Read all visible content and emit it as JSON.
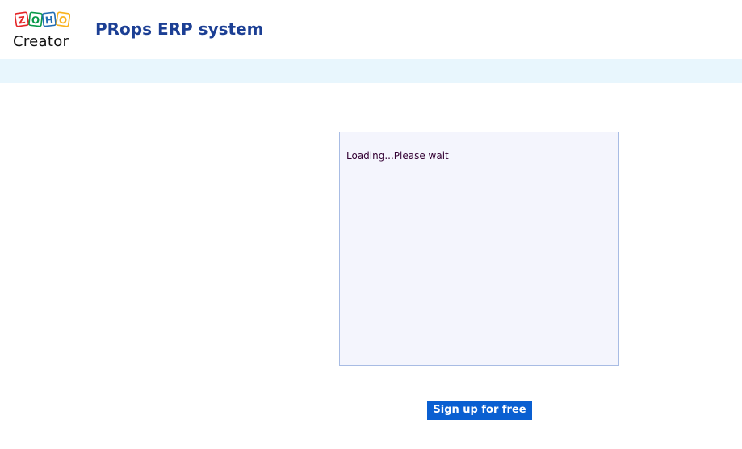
{
  "brand": {
    "logo_letters": [
      "Z",
      "O",
      "H",
      "O"
    ],
    "logo_colors": [
      "#e42527",
      "#089949",
      "#226db4",
      "#f9b21d"
    ],
    "logo_product": "Creator"
  },
  "header": {
    "app_title": "PRops ERP system"
  },
  "colors": {
    "title": "#1c3f94",
    "band": "#e8f6fd",
    "panel_bg": "#f4f5fd",
    "panel_border": "#a8bce4",
    "button_bg": "#0a5fd1"
  },
  "main": {
    "loading_text": "Loading...Please wait",
    "signup_label": "Sign up for free"
  }
}
